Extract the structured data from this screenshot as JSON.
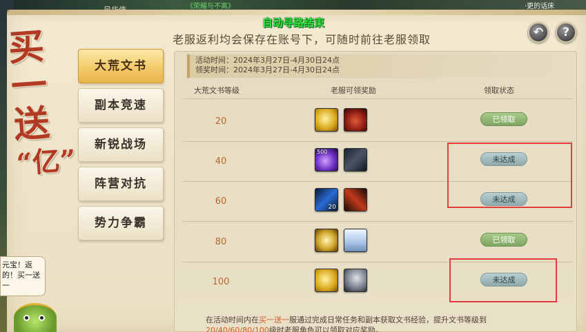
{
  "background": {
    "game_name": "风华值",
    "quest_top": "《荣耀与不离》",
    "top_right": "·更的话床"
  },
  "promo_title": [
    "买",
    "一",
    "送",
    "“亿”"
  ],
  "nav_hint": "自动寻路结束",
  "subtitle": "老服返利均会保存在账号下，可随时前往老服领取",
  "buttons": {
    "back": "↶",
    "help": "?"
  },
  "tabs": [
    {
      "label": "大荒文书",
      "active": true
    },
    {
      "label": "副本竞速",
      "active": false
    },
    {
      "label": "新锐战场",
      "active": false
    },
    {
      "label": "阵营对抗",
      "active": false
    },
    {
      "label": "势力争霸",
      "active": false
    }
  ],
  "time_info": {
    "activity": "活动时间：2024年3月27日-4月30日24点",
    "claim": "领奖时间：2024年3月27日-4月30日24点"
  },
  "columns": {
    "level": "大荒文书等级",
    "rewards": "老服可领奖励",
    "status": "领取状态"
  },
  "rows": [
    {
      "level": "20",
      "status": "已领取",
      "claimed": true,
      "items": [
        {
          "icon": "gold-ingot-icon",
          "qty": ""
        },
        {
          "icon": "red-gift-box-icon",
          "qty": ""
        }
      ]
    },
    {
      "level": "40",
      "status": "未达成",
      "claimed": false,
      "items": [
        {
          "icon": "purple-crystal-icon",
          "qty": "500"
        },
        {
          "icon": "dark-weapon-icon",
          "qty": ""
        }
      ]
    },
    {
      "level": "60",
      "status": "未达成",
      "claimed": false,
      "items": [
        {
          "icon": "blue-scroll-icon",
          "qty": "20"
        },
        {
          "icon": "flame-staff-icon",
          "qty": ""
        }
      ]
    },
    {
      "level": "80",
      "status": "已领取",
      "claimed": true,
      "items": [
        {
          "icon": "golden-orb-icon",
          "qty": ""
        },
        {
          "icon": "white-wings-icon",
          "qty": ""
        }
      ]
    },
    {
      "level": "100",
      "status": "未达成",
      "claimed": false,
      "items": [
        {
          "icon": "gold-ingot-icon",
          "qty": ""
        },
        {
          "icon": "horse-mount-icon",
          "qty": ""
        }
      ]
    }
  ],
  "footer": {
    "part1": "在活动时间内在",
    "highlight": "买一送一",
    "part2": "服通过完成日常任务和副本获取文书经验，提升文书等级到",
    "levels": "20/40/60/80/100",
    "part3": "级时老服角色可以领取对应奖励。"
  },
  "chat_bubble": "元宝！返的！买一送一",
  "colors": {
    "accent_orange": "#d65a22",
    "title_red": "#b23a24",
    "nav_hint_green": "#2fe43a",
    "highlight_red": "#e23c3c"
  }
}
